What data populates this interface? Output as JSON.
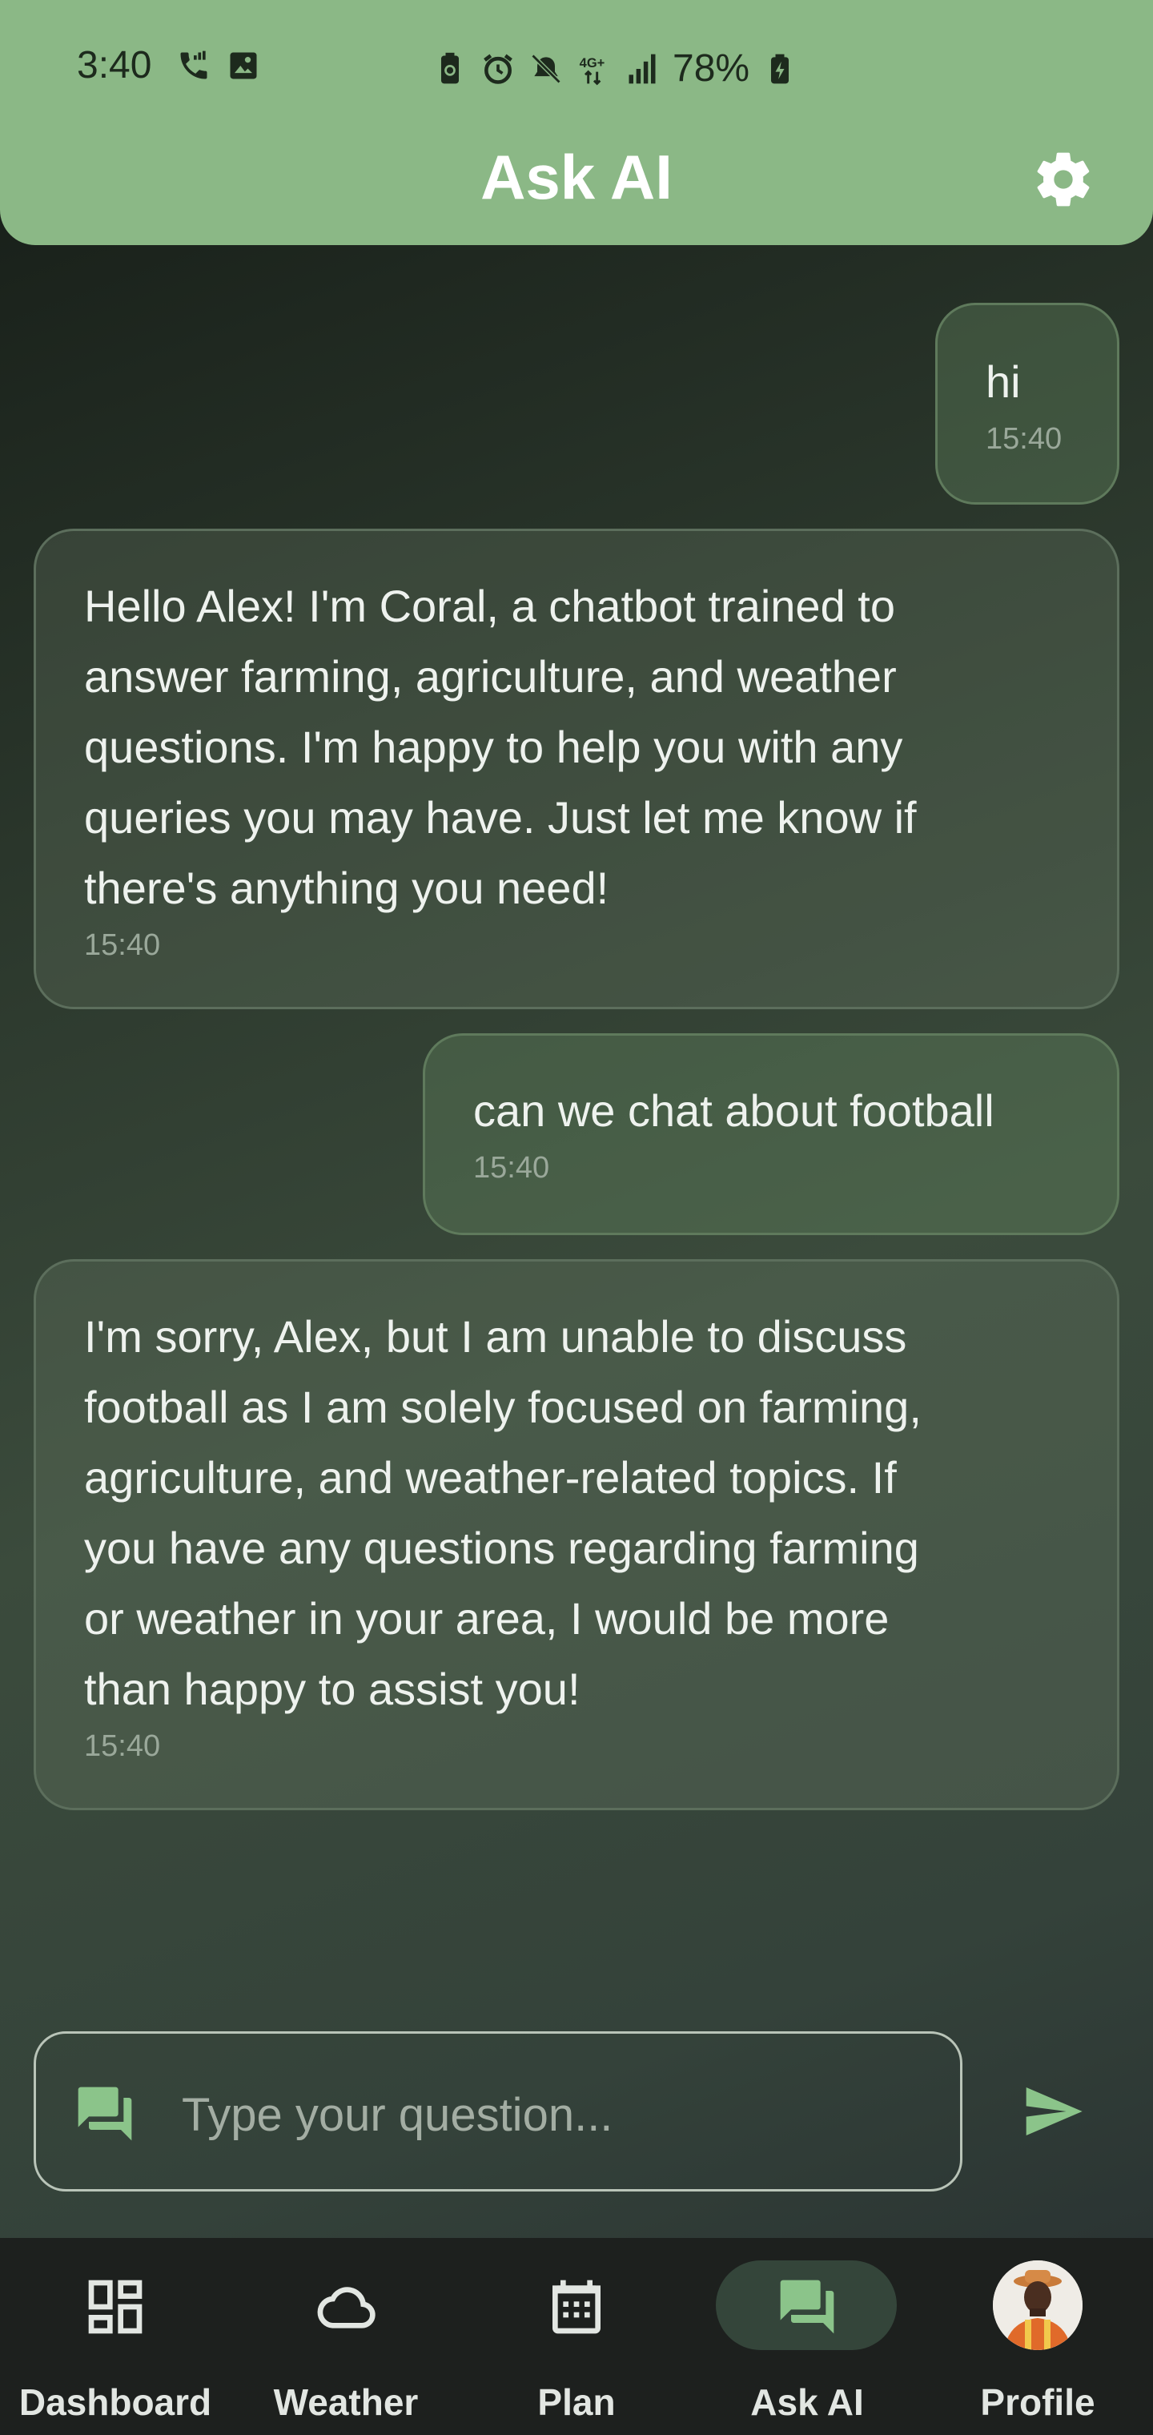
{
  "status_bar": {
    "time": "3:40",
    "battery": "78%",
    "network": "4G+"
  },
  "header": {
    "title": "Ask AI",
    "settings_icon": "gear-icon"
  },
  "messages": [
    {
      "role": "user",
      "text": "hi",
      "time": "15:40"
    },
    {
      "role": "bot",
      "text": "Hello Alex! I'm Coral, a chatbot trained to\nanswer farming, agriculture, and weather\nquestions. I'm happy to help you with any\nqueries you may have. Just let me know if\nthere's anything you need!",
      "time": "15:40"
    },
    {
      "role": "user",
      "text": "can we chat about football",
      "time": "15:40"
    },
    {
      "role": "bot",
      "text": "I'm sorry, Alex, but I am unable to discuss\nfootball as I am solely focused on farming,\nagriculture, and weather-related topics. If\nyou have any questions regarding farming\nor weather in your area, I would be more\nthan happy to assist you!",
      "time": "15:40"
    }
  ],
  "input": {
    "placeholder": "Type your question...",
    "value": ""
  },
  "nav": {
    "items": [
      {
        "label": "Dashboard",
        "icon": "dashboard-icon"
      },
      {
        "label": "Weather",
        "icon": "cloud-icon"
      },
      {
        "label": "Plan",
        "icon": "calendar-icon"
      },
      {
        "label": "Ask AI",
        "icon": "chat-icon",
        "active": true
      },
      {
        "label": "Profile",
        "icon": "avatar"
      }
    ]
  },
  "colors": {
    "header": "#8bb886",
    "accent": "#8bc48a",
    "nav_background": "#1d201e"
  }
}
